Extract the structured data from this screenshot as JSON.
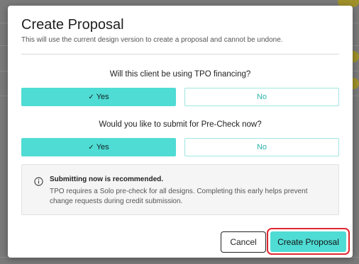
{
  "modal": {
    "title": "Create Proposal",
    "subtitle": "This will use the current design version to create a proposal and cannot be undone.",
    "questions": [
      {
        "text": "Will this client be using TPO financing?",
        "yes_label": "Yes",
        "no_label": "No",
        "selected": "Yes"
      },
      {
        "text": "Would you like to submit for Pre-Check now?",
        "yes_label": "Yes",
        "no_label": "No",
        "selected": "Yes"
      }
    ],
    "info": {
      "title": "Submitting now is recommended.",
      "body": "TPO requires a Solo pre-check for all designs. Completing this early helps prevent change requests during credit submission."
    },
    "buttons": {
      "cancel": "Cancel",
      "create": "Create Proposal"
    }
  },
  "colors": {
    "accent": "#4fdcd4",
    "highlight_outline": "#e0262f"
  }
}
